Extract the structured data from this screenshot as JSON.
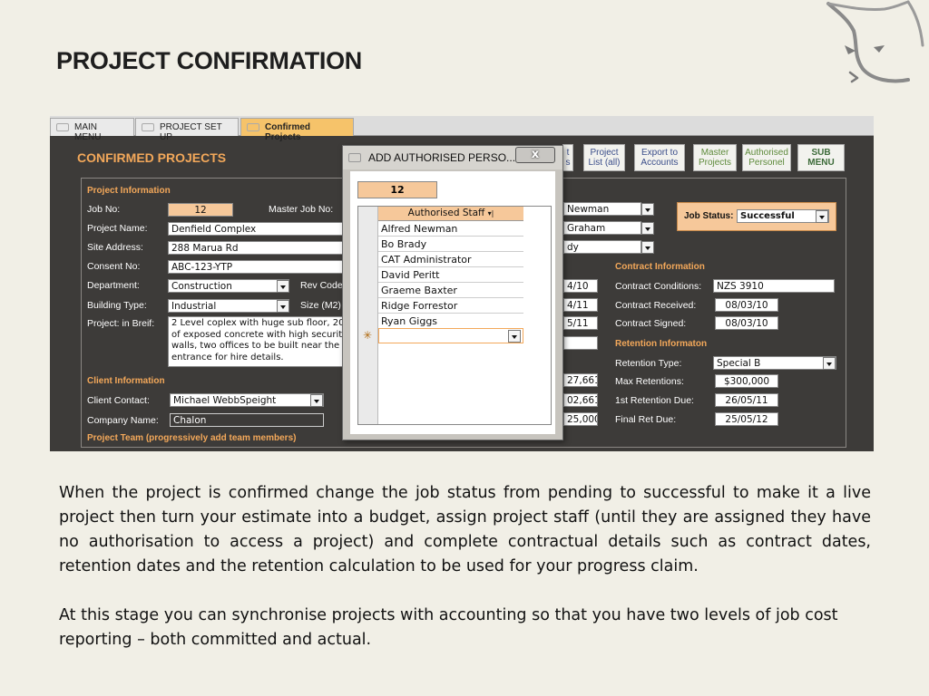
{
  "slide": {
    "title": "PROJECT CONFIRMATION",
    "paragraphs": [
      "When the project is confirmed change the job status from pending to successful to make it a live project then turn your estimate into a budget, assign project staff (until they are assigned they have no authorisation to access a project) and complete contractual details such as contract dates, retention dates and the retention calculation to be used for your progress claim.",
      "At this stage you can synchronise projects with accounting so that you have two levels of job cost reporting – both committed and actual."
    ]
  },
  "tabs": [
    "MAIN MENU",
    "PROJECT SET UP",
    "Confirmed Projects"
  ],
  "form": {
    "heading": "CONFIRMED PROJECTS",
    "buttons": {
      "partial": [
        "t",
        "s"
      ],
      "project_list": [
        "Project",
        "List (all)"
      ],
      "export": [
        "Export to",
        "Accounts"
      ],
      "master_projects": [
        "Master",
        "Projects"
      ],
      "authorised_personel": [
        "Authorised",
        "Personel"
      ],
      "sub_menu": [
        "SUB",
        "MENU"
      ]
    },
    "project_info": {
      "section": "Project Information",
      "job_no_label": "Job No:",
      "job_no": "12",
      "master_job_label": "Master Job No:",
      "project_name_label": "Project Name:",
      "project_name": "Denfield Complex",
      "site_address_label": "Site Address:",
      "site_address": "288 Marua Rd",
      "consent_label": "Consent No:",
      "consent": "ABC-123-YTP",
      "department_label": "Department:",
      "department": "Construction",
      "rev_code_label": "Rev Code",
      "building_type_label": "Building Type:",
      "building_type": "Industrial",
      "size_label": "Size (M2)",
      "brief_label": "Project: in Breif:",
      "brief": "2 Level coplex with huge sub floor, 20 of exposed concrete with high securit walls, two offices to be built near the entrance for hire details."
    },
    "client_info": {
      "section": "Client Information",
      "contact_label": "Client Contact:",
      "contact": "Michael WebbSpeight",
      "company_label": "Company Name:",
      "company": "Chalon"
    },
    "team_section": "Project Team (progressively add team members)",
    "staff_fields": [
      "Newman",
      "Graham",
      "dy"
    ],
    "dates_partial": [
      "4/10",
      "4/11",
      "5/11"
    ],
    "amounts_partial": [
      "27,661",
      "02,661",
      "25,000"
    ],
    "job_status": {
      "label": "Job Status:",
      "value": "Successful"
    },
    "contract": {
      "section": "Contract Information",
      "conditions_label": "Contract Conditions:",
      "conditions": "NZS 3910",
      "received_label": "Contract Received:",
      "received": "08/03/10",
      "signed_label": "Contract Signed:",
      "signed": "08/03/10"
    },
    "retention": {
      "section": "Retention Informaton",
      "type_label": "Retention Type:",
      "type": "Special B",
      "max_label": "Max Retentions:",
      "max": "$300,000",
      "first_due_label": "1st Retention Due:",
      "first_due": "26/05/11",
      "final_due_label": "Final Ret Due:",
      "final_due": "25/05/12"
    }
  },
  "dialog": {
    "title": "ADD AUTHORISED PERSO...",
    "close": "x",
    "job_no": "12",
    "column_header": "Authorised Staff",
    "rows": [
      "Alfred Newman",
      "Bo Brady",
      "CAT Administrator",
      "David Peritt",
      "Graeme Baxter",
      "Ridge Forrestor",
      "Ryan Giggs"
    ],
    "new_row_marker": "✳"
  },
  "colors": {
    "accent_orange": "#f3a85a",
    "field_orange": "#f6c89a",
    "panel_bg": "#3d3b39",
    "slide_bg": "#f1efe6"
  }
}
